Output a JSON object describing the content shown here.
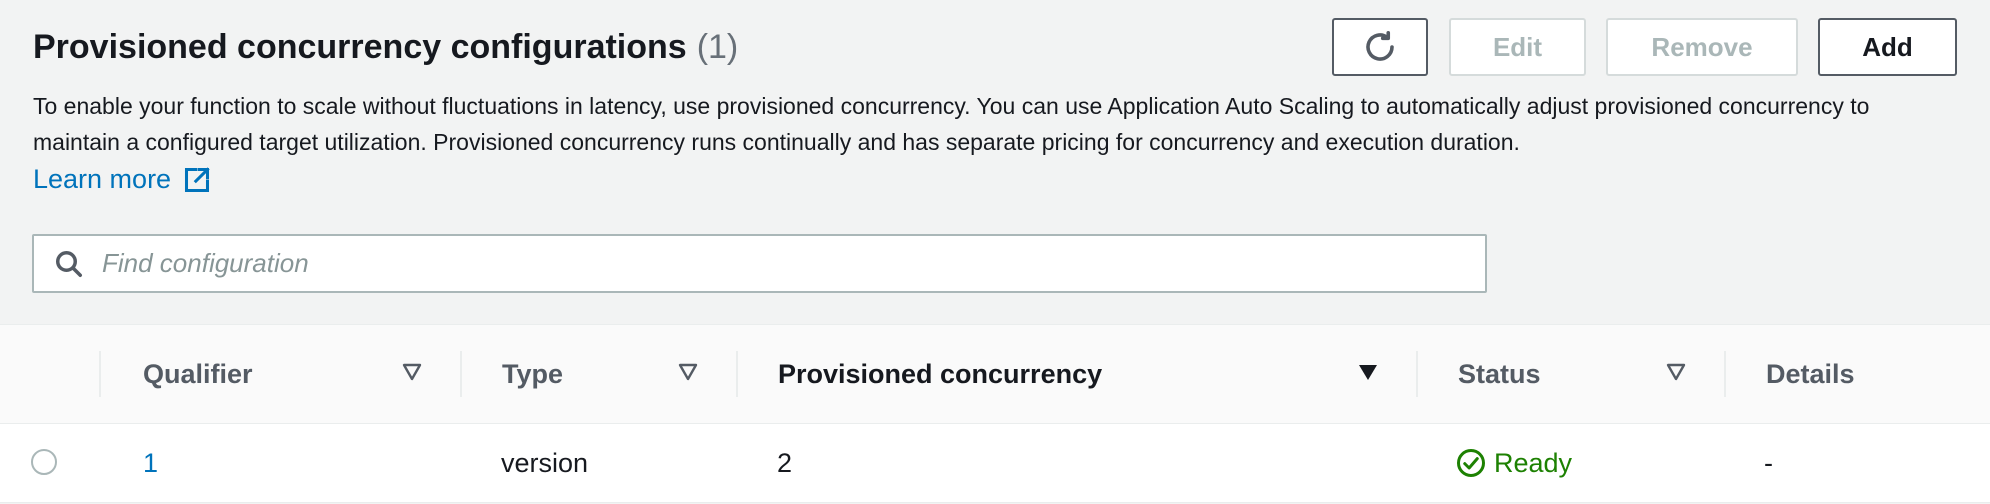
{
  "header": {
    "title": "Provisioned concurrency configurations",
    "count": "(1)"
  },
  "actions": {
    "refresh_icon": "refresh-icon",
    "edit_label": "Edit",
    "remove_label": "Remove",
    "add_label": "Add"
  },
  "description": {
    "text": "To enable your function to scale without fluctuations in latency, use provisioned concurrency. You can use Application Auto Scaling to automatically adjust provisioned concurrency to maintain a configured target utilization. Provisioned concurrency runs continually and has separate pricing for concurrency and execution duration.",
    "learn_more": "Learn more",
    "learn_more_icon": "external-link-icon"
  },
  "search": {
    "placeholder": "Find configuration",
    "value": ""
  },
  "table": {
    "columns": [
      {
        "label": "Qualifier",
        "sort": "none"
      },
      {
        "label": "Type",
        "sort": "none"
      },
      {
        "label": "Provisioned concurrency",
        "sort": "descending"
      },
      {
        "label": "Status",
        "sort": "none"
      },
      {
        "label": "Details"
      }
    ],
    "rows": [
      {
        "qualifier": "1",
        "type": "version",
        "provisioned_concurrency": "2",
        "status": "Ready",
        "status_icon": "check-circle-icon",
        "details": "-"
      }
    ]
  },
  "colors": {
    "link": "#0073bb",
    "success": "#1d8102",
    "background": "#f2f3f3"
  }
}
